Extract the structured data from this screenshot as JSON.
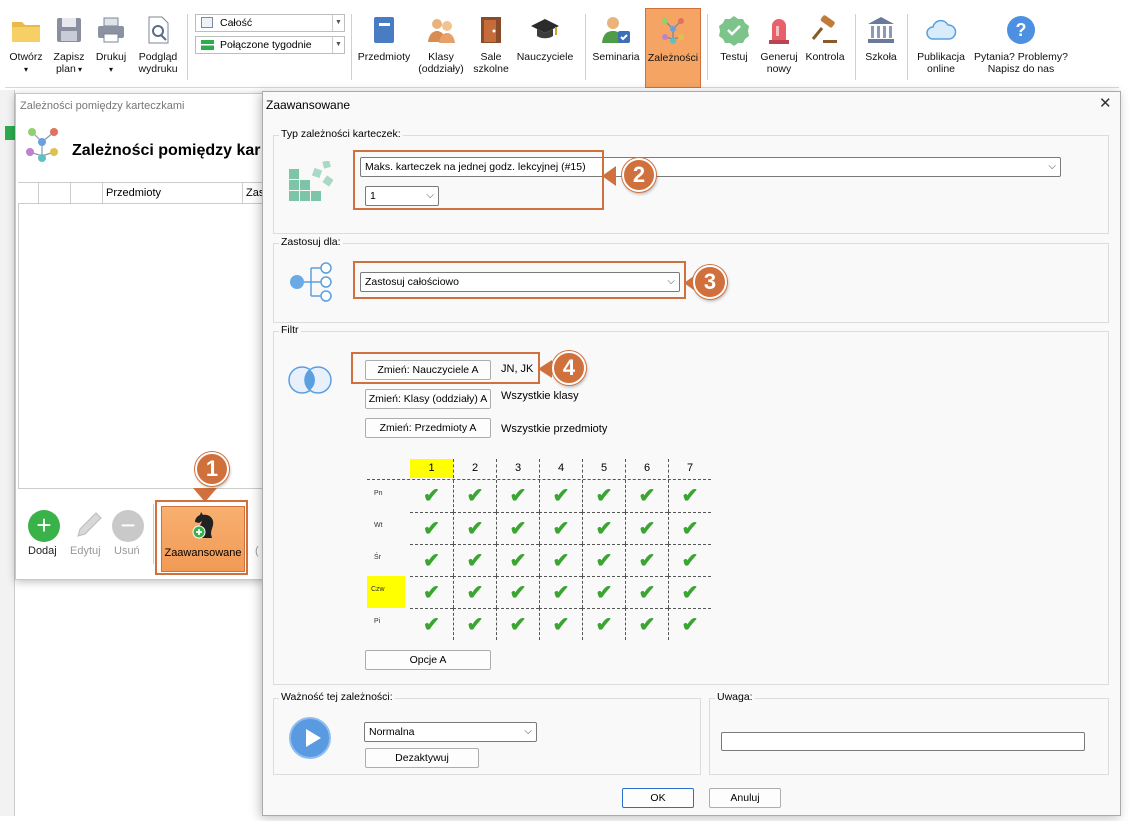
{
  "ribbon": {
    "otworz": "Otwórz",
    "zapisz": "Zapisz",
    "plan": "plan",
    "drukuj": "Drukuj",
    "podglad": "Podgląd",
    "wydruku": "wydruku",
    "combo1": "Całość",
    "combo2": "Połączone tygodnie",
    "przedmioty": "Przedmioty",
    "klasy": "Klasy",
    "oddzialy": "(oddziały)",
    "sale": "Sale",
    "szkolne": "szkolne",
    "nauczyciele": "Nauczyciele",
    "seminaria": "Seminaria",
    "zaleznosci": "Zależności",
    "testuj": "Testuj",
    "generuj": "Generuj",
    "nowy": "nowy",
    "kontrola": "Kontrola",
    "szkola": "Szkoła",
    "publikacja": "Publikacja",
    "online": "online",
    "pytania": "Pytania? Problemy?",
    "napisz": "Napisz do nas"
  },
  "leftwin": {
    "title": "Zależności pomiędzy karteczkami",
    "heading": "Zależności pomiędzy kar",
    "col1": "Przedmioty",
    "col2": "Zas",
    "dodaj": "Dodaj",
    "edytuj": "Edytuj",
    "usun": "Usuń",
    "zaawansowane": "Zaawansowane",
    "trailing": "("
  },
  "dialog": {
    "title": "Zaawansowane",
    "close": "✕",
    "typ_label": "Typ zależności karteczek:",
    "typ_value": "Maks. karteczek na jednej godz. lekcyjnej (#15)",
    "typ_num": "1",
    "zastosuj_label": "Zastosuj dla:",
    "zastosuj_value": "Zastosuj całościowo",
    "filtr_label": "Filtr",
    "btn_nauczyciele": "Zmień: Nauczyciele A",
    "val_nauczyciele": "JN, JK",
    "btn_klasy": "Zmień: Klasy (oddziały) A",
    "val_klasy": "Wszystkie klasy",
    "btn_przedmioty": "Zmień: Przedmioty A",
    "val_przedmioty": "Wszystkie przedmioty",
    "periods": [
      "1",
      "2",
      "3",
      "4",
      "5",
      "6",
      "7"
    ],
    "days": [
      "Pn",
      "Wt",
      "Śr",
      "Czw",
      "Pi"
    ],
    "opcje": "Opcje A",
    "waznosc_label": "Ważność tej zależności:",
    "waznosc_value": "Normalna",
    "dezaktywuj": "Dezaktywuj",
    "uwaga_label": "Uwaga:",
    "ok": "OK",
    "anuluj": "Anuluj"
  },
  "badges": [
    "1",
    "2",
    "3",
    "4"
  ],
  "colors": {
    "highlight": "#d0703c",
    "yellow": "#ffff00",
    "check": "#3aa533"
  }
}
